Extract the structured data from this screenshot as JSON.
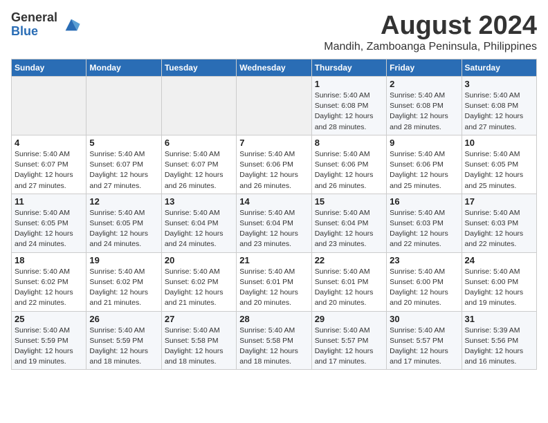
{
  "header": {
    "logo_general": "General",
    "logo_blue": "Blue",
    "month_year": "August 2024",
    "location": "Mandih, Zamboanga Peninsula, Philippines"
  },
  "days_of_week": [
    "Sunday",
    "Monday",
    "Tuesday",
    "Wednesday",
    "Thursday",
    "Friday",
    "Saturday"
  ],
  "weeks": [
    [
      {
        "day": "",
        "info": ""
      },
      {
        "day": "",
        "info": ""
      },
      {
        "day": "",
        "info": ""
      },
      {
        "day": "",
        "info": ""
      },
      {
        "day": "1",
        "info": "Sunrise: 5:40 AM\nSunset: 6:08 PM\nDaylight: 12 hours\nand 28 minutes."
      },
      {
        "day": "2",
        "info": "Sunrise: 5:40 AM\nSunset: 6:08 PM\nDaylight: 12 hours\nand 28 minutes."
      },
      {
        "day": "3",
        "info": "Sunrise: 5:40 AM\nSunset: 6:08 PM\nDaylight: 12 hours\nand 27 minutes."
      }
    ],
    [
      {
        "day": "4",
        "info": "Sunrise: 5:40 AM\nSunset: 6:07 PM\nDaylight: 12 hours\nand 27 minutes."
      },
      {
        "day": "5",
        "info": "Sunrise: 5:40 AM\nSunset: 6:07 PM\nDaylight: 12 hours\nand 27 minutes."
      },
      {
        "day": "6",
        "info": "Sunrise: 5:40 AM\nSunset: 6:07 PM\nDaylight: 12 hours\nand 26 minutes."
      },
      {
        "day": "7",
        "info": "Sunrise: 5:40 AM\nSunset: 6:06 PM\nDaylight: 12 hours\nand 26 minutes."
      },
      {
        "day": "8",
        "info": "Sunrise: 5:40 AM\nSunset: 6:06 PM\nDaylight: 12 hours\nand 26 minutes."
      },
      {
        "day": "9",
        "info": "Sunrise: 5:40 AM\nSunset: 6:06 PM\nDaylight: 12 hours\nand 25 minutes."
      },
      {
        "day": "10",
        "info": "Sunrise: 5:40 AM\nSunset: 6:05 PM\nDaylight: 12 hours\nand 25 minutes."
      }
    ],
    [
      {
        "day": "11",
        "info": "Sunrise: 5:40 AM\nSunset: 6:05 PM\nDaylight: 12 hours\nand 24 minutes."
      },
      {
        "day": "12",
        "info": "Sunrise: 5:40 AM\nSunset: 6:05 PM\nDaylight: 12 hours\nand 24 minutes."
      },
      {
        "day": "13",
        "info": "Sunrise: 5:40 AM\nSunset: 6:04 PM\nDaylight: 12 hours\nand 24 minutes."
      },
      {
        "day": "14",
        "info": "Sunrise: 5:40 AM\nSunset: 6:04 PM\nDaylight: 12 hours\nand 23 minutes."
      },
      {
        "day": "15",
        "info": "Sunrise: 5:40 AM\nSunset: 6:04 PM\nDaylight: 12 hours\nand 23 minutes."
      },
      {
        "day": "16",
        "info": "Sunrise: 5:40 AM\nSunset: 6:03 PM\nDaylight: 12 hours\nand 22 minutes."
      },
      {
        "day": "17",
        "info": "Sunrise: 5:40 AM\nSunset: 6:03 PM\nDaylight: 12 hours\nand 22 minutes."
      }
    ],
    [
      {
        "day": "18",
        "info": "Sunrise: 5:40 AM\nSunset: 6:02 PM\nDaylight: 12 hours\nand 22 minutes."
      },
      {
        "day": "19",
        "info": "Sunrise: 5:40 AM\nSunset: 6:02 PM\nDaylight: 12 hours\nand 21 minutes."
      },
      {
        "day": "20",
        "info": "Sunrise: 5:40 AM\nSunset: 6:02 PM\nDaylight: 12 hours\nand 21 minutes."
      },
      {
        "day": "21",
        "info": "Sunrise: 5:40 AM\nSunset: 6:01 PM\nDaylight: 12 hours\nand 20 minutes."
      },
      {
        "day": "22",
        "info": "Sunrise: 5:40 AM\nSunset: 6:01 PM\nDaylight: 12 hours\nand 20 minutes."
      },
      {
        "day": "23",
        "info": "Sunrise: 5:40 AM\nSunset: 6:00 PM\nDaylight: 12 hours\nand 20 minutes."
      },
      {
        "day": "24",
        "info": "Sunrise: 5:40 AM\nSunset: 6:00 PM\nDaylight: 12 hours\nand 19 minutes."
      }
    ],
    [
      {
        "day": "25",
        "info": "Sunrise: 5:40 AM\nSunset: 5:59 PM\nDaylight: 12 hours\nand 19 minutes."
      },
      {
        "day": "26",
        "info": "Sunrise: 5:40 AM\nSunset: 5:59 PM\nDaylight: 12 hours\nand 18 minutes."
      },
      {
        "day": "27",
        "info": "Sunrise: 5:40 AM\nSunset: 5:58 PM\nDaylight: 12 hours\nand 18 minutes."
      },
      {
        "day": "28",
        "info": "Sunrise: 5:40 AM\nSunset: 5:58 PM\nDaylight: 12 hours\nand 18 minutes."
      },
      {
        "day": "29",
        "info": "Sunrise: 5:40 AM\nSunset: 5:57 PM\nDaylight: 12 hours\nand 17 minutes."
      },
      {
        "day": "30",
        "info": "Sunrise: 5:40 AM\nSunset: 5:57 PM\nDaylight: 12 hours\nand 17 minutes."
      },
      {
        "day": "31",
        "info": "Sunrise: 5:39 AM\nSunset: 5:56 PM\nDaylight: 12 hours\nand 16 minutes."
      }
    ]
  ]
}
